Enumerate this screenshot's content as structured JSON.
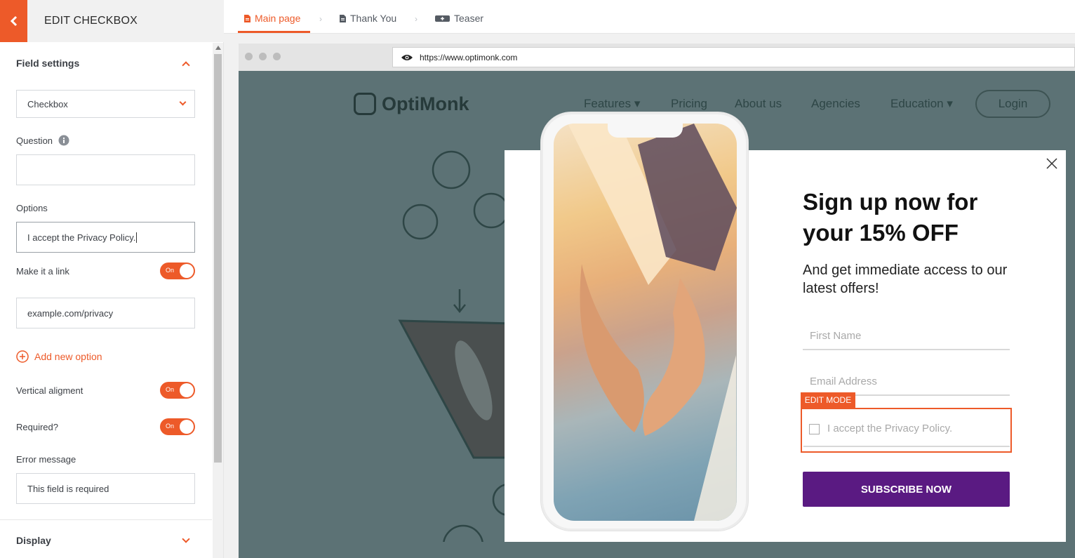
{
  "panel": {
    "title": "EDIT CHECKBOX",
    "field_settings": "Field settings",
    "type_select": "Checkbox",
    "question_label": "Question",
    "question_value": "",
    "options_label": "Options",
    "option_value": "I accept the Privacy Policy.",
    "make_link_label": "Make it a link",
    "toggle_on": "On",
    "link_value": "example.com/privacy",
    "add_option": "Add new option",
    "vertical_label": "Vertical aligment",
    "required_label": "Required?",
    "error_label": "Error message",
    "error_value": "This field is required",
    "display": "Display"
  },
  "tabs": [
    {
      "label": "Main page"
    },
    {
      "label": "Thank You"
    },
    {
      "label": "Teaser"
    }
  ],
  "browser": {
    "url": "https://www.optimonk.com"
  },
  "site": {
    "logo": "OptiMonk",
    "nav": [
      "Features",
      "Pricing",
      "About us",
      "Agencies",
      "Education"
    ],
    "login": "Login"
  },
  "popup": {
    "headline": "Sign up now for your 15% OFF",
    "subline": "And get immediate access to our latest offers!",
    "first_name_placeholder": "First Name",
    "email_placeholder": "Email Address",
    "edit_badge": "EDIT MODE",
    "checkbox_label": "I accept the Privacy Policy.",
    "button": "SUBSCRIBE NOW"
  },
  "colors": {
    "accent": "#ed5a29",
    "button": "#5a1a82",
    "overlay": "#5c7275"
  }
}
